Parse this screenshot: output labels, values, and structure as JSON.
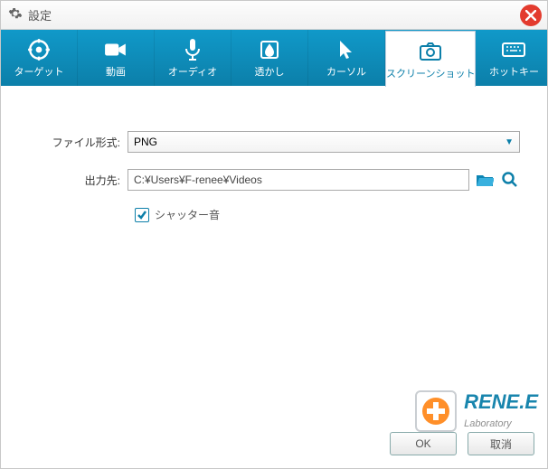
{
  "window": {
    "title": "設定"
  },
  "tabs": [
    {
      "id": "target",
      "label": "ターゲット"
    },
    {
      "id": "video",
      "label": "動画"
    },
    {
      "id": "audio",
      "label": "オーディオ"
    },
    {
      "id": "watermark",
      "label": "透かし"
    },
    {
      "id": "cursor",
      "label": "カーソル"
    },
    {
      "id": "screenshot",
      "label": "スクリーンショット",
      "active": true
    },
    {
      "id": "hotkey",
      "label": "ホットキー"
    }
  ],
  "form": {
    "format_label": "ファイル形式:",
    "format_value": "PNG",
    "output_label": "出力先:",
    "output_value": "C:¥Users¥F-renee¥Videos",
    "shutter_label": "シャッター音",
    "shutter_checked": true
  },
  "buttons": {
    "ok": "OK",
    "cancel": "取消"
  },
  "brand": {
    "name": "RENE.E",
    "sub": "Laboratory"
  },
  "colors": {
    "accent": "#0c7fa9",
    "close": "#e33b2e",
    "orange": "#ff8a1e"
  }
}
